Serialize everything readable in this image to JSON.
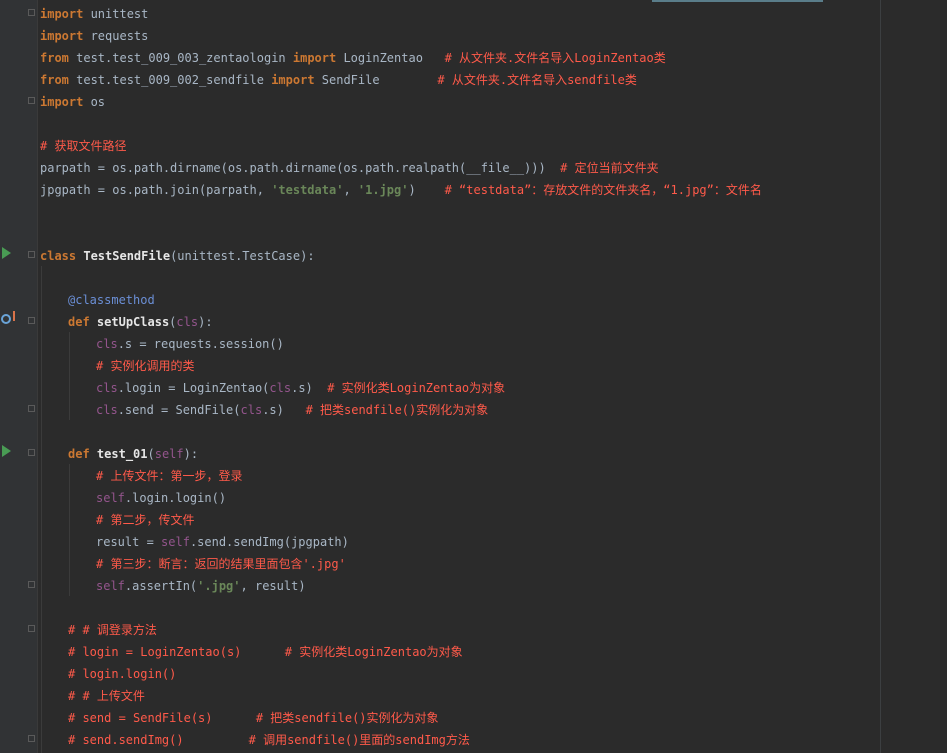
{
  "lines": {
    "l1": [
      "import",
      " unittest"
    ],
    "l2": [
      "import",
      " requests"
    ],
    "l3": [
      "from",
      " test.test_009_003_zentaologin ",
      "import",
      " LoginZentao   ",
      "# 从文件夹.文件名导入LoginZentao类"
    ],
    "l4": [
      "from",
      " test.test_009_002_sendfile ",
      "import",
      " SendFile        ",
      "# 从文件夹.文件名导入sendfile类"
    ],
    "l5": [
      "import",
      " os"
    ],
    "l7": [
      "# 获取文件路径"
    ],
    "l8": [
      "parpath = os.path.dirname(os.path.dirname(os.path.realpath(__file__)))  ",
      "# 定位当前文件夹"
    ],
    "l9": [
      "jpgpath = os.path.join(parpath, ",
      "'testdata'",
      ", ",
      "'1.jpg'",
      ")    ",
      "# “testdata”：存放文件的文件夹名，“1.jpg”：文件名"
    ],
    "l12": [
      "class",
      " ",
      "TestSendFile",
      "(unittest.TestCase):"
    ],
    "l14": [
      "@classmethod"
    ],
    "l15": [
      "def",
      " ",
      "setUpClass",
      "(",
      "cls",
      "):"
    ],
    "l16": [
      "cls",
      ".s = requests.session()"
    ],
    "l17": [
      "# 实例化调用的类"
    ],
    "l18": [
      "cls",
      ".login = LoginZentao(",
      "cls",
      ".s)  ",
      "# 实例化类LoginZentao为对象"
    ],
    "l19": [
      "cls",
      ".send = SendFile(",
      "cls",
      ".s)   ",
      "# 把类sendfile()实例化为对象"
    ],
    "l21": [
      "def",
      " ",
      "test_01",
      "(",
      "self",
      "):"
    ],
    "l22": [
      "# 上传文件：第一步，登录"
    ],
    "l23": [
      "self",
      ".login.login()"
    ],
    "l24": [
      "# 第二步，传文件"
    ],
    "l25": [
      "result = ",
      "self",
      ".send.sendImg(jpgpath)"
    ],
    "l26": [
      "# 第三步：断言：返回的结果里面包含'.jpg'"
    ],
    "l27": [
      "self",
      ".assertIn(",
      "'.jpg'",
      ", result)"
    ],
    "l29": [
      "# # 调登录方法"
    ],
    "l30": [
      "# login = LoginZentao(s)      # 实例化类LoginZentao为对象"
    ],
    "l31": [
      "# login.login()"
    ],
    "l32": [
      "# # 上传文件"
    ],
    "l33": [
      "# send = SendFile(s)      # 把类sendfile()实例化为对象"
    ],
    "l34": [
      "# send.sendImg()         # 调用sendfile()里面的sendImg方法"
    ]
  }
}
